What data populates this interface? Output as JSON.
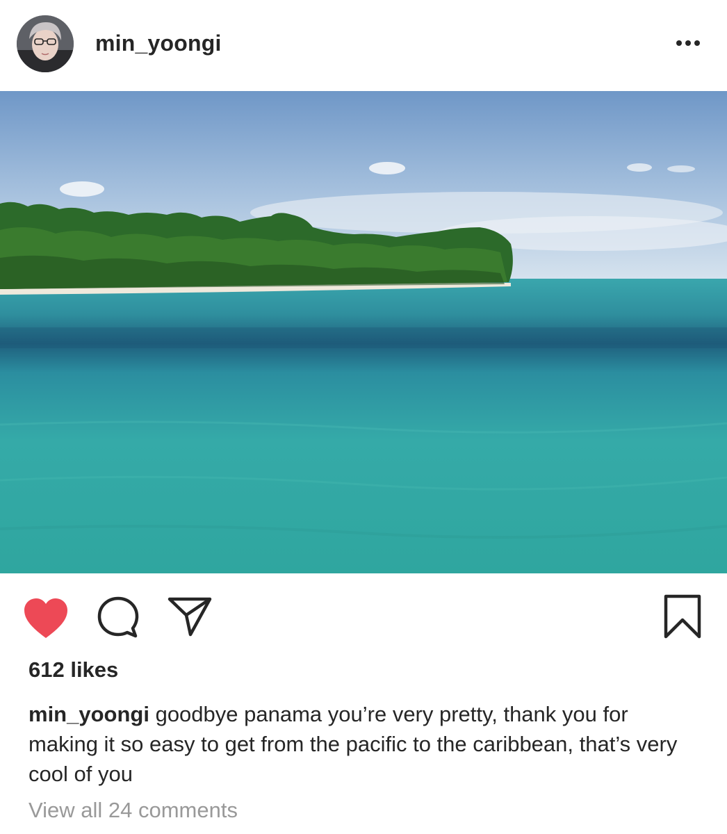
{
  "post": {
    "username": "min_yoongi",
    "avatar_icon": "profile-photo",
    "more_icon": "more-horizontal-icon",
    "photo_description_icon": "tropical-island-photo"
  },
  "actions": {
    "like_icon": "heart-icon",
    "like_active": true,
    "like_color": "#ed4956",
    "comment_icon": "comment-icon",
    "share_icon": "paper-plane-icon",
    "save_icon": "bookmark-icon"
  },
  "likes": {
    "text": "612 likes"
  },
  "caption": {
    "username": "min_yoongi",
    "text": "goodbye panama you’re very pretty, thank you for making it so easy to get from the pacific to the caribbean, that’s very cool of you"
  },
  "comments": {
    "view_all_text": "View all 24 comments"
  },
  "colors": {
    "text": "#262626",
    "muted": "#999999",
    "background": "#ffffff"
  }
}
